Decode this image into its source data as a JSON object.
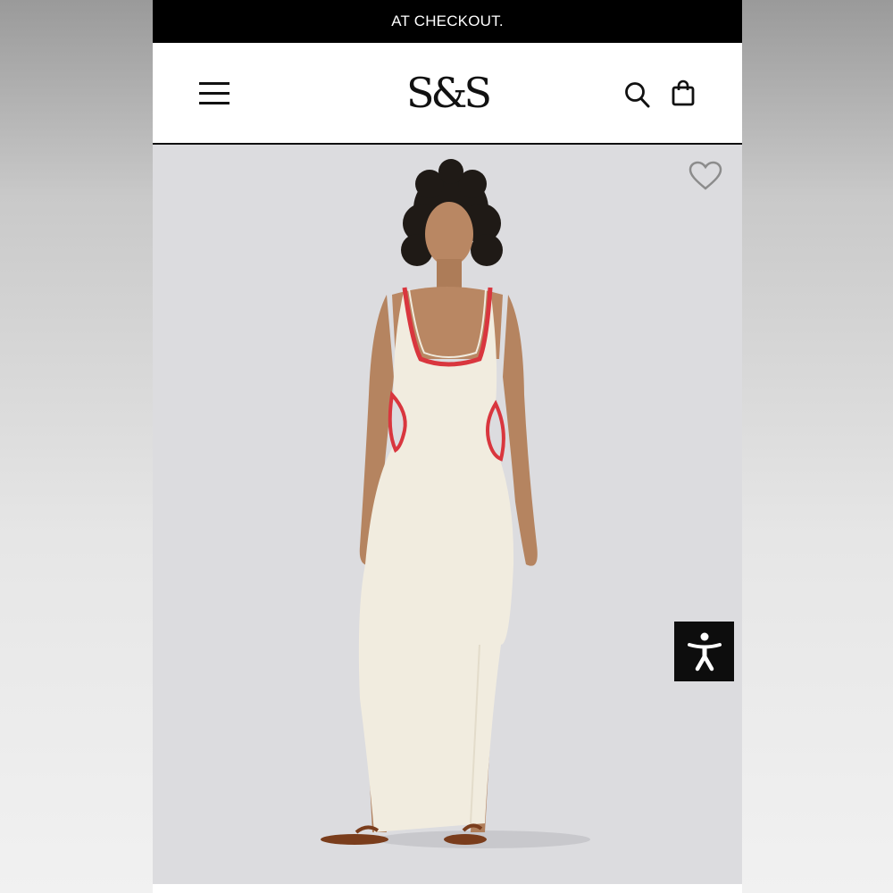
{
  "promo_banner": {
    "text": "AT CHECKOUT."
  },
  "header": {
    "logo_text": "S&S",
    "icons": {
      "menu": "hamburger-menu-icon",
      "search": "search-icon",
      "bag": "shopping-bag-icon"
    }
  },
  "product": {
    "image": "woman-in-cream-ribbed-knit-maxi-dress-with-red-trim-and-side-cutouts",
    "wishlist_icon": "heart-outline-icon"
  },
  "accessibility_widget": {
    "icon": "accessibility-person-icon"
  },
  "colors": {
    "banner_bg": "#000000",
    "header_bg": "#ffffff",
    "image_bg": "#dcdcdf",
    "dress": "#f1ecdf",
    "trim_red": "#d9363e",
    "page_outer": "#c9c9c9"
  }
}
